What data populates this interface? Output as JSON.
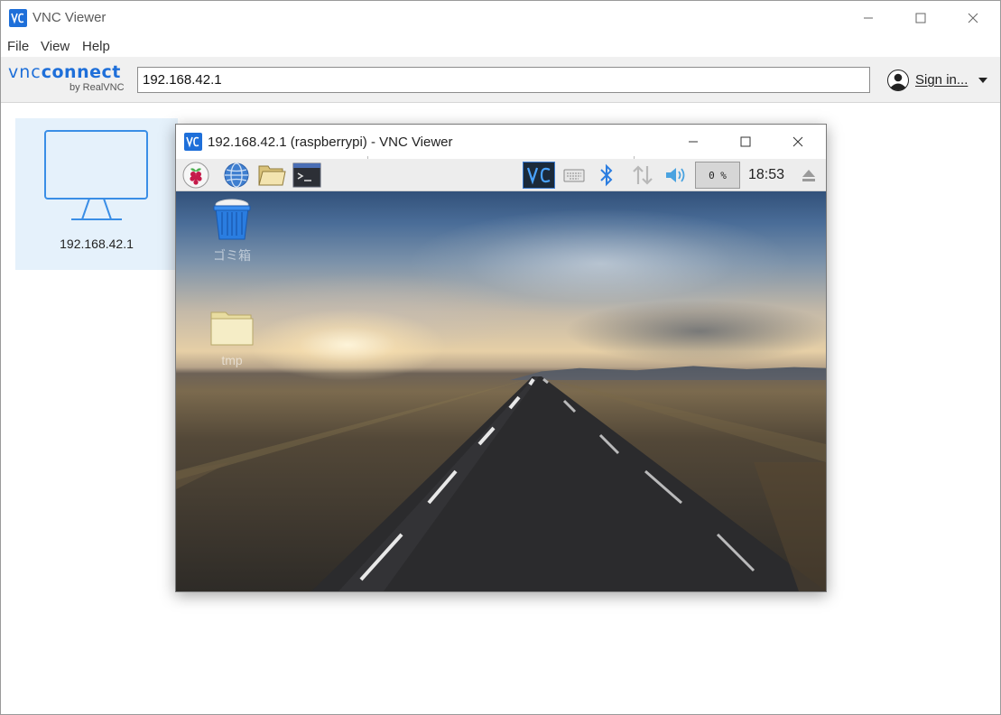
{
  "window": {
    "title": "VNC Viewer"
  },
  "menu": {
    "items": [
      "File",
      "View",
      "Help"
    ]
  },
  "toolbar": {
    "logo_main": "VNC CONNECT",
    "logo_vnc": "vnc",
    "logo_connect": "connect",
    "logo_sub": "by RealVNC",
    "address_value": "192.168.42.1",
    "signin_label": "Sign in..."
  },
  "address_book": {
    "items": [
      {
        "label": "192.168.42.1",
        "icon": "monitor-icon",
        "selected": true
      }
    ]
  },
  "remote_window": {
    "title": "192.168.42.1 (raspberrypi) - VNC Viewer",
    "taskbar": {
      "launchers": [
        "raspberry-menu-icon",
        "web-browser-icon",
        "file-manager-icon",
        "terminal-icon"
      ],
      "tray": [
        "vnc-server-icon",
        "keyboard-icon",
        "bluetooth-icon",
        "network-icon",
        "volume-icon"
      ],
      "cpu_usage": "0 %",
      "clock": "18:53",
      "eject_icon": "eject-icon"
    },
    "desktop_icons": [
      {
        "label": "ゴミ箱",
        "icon": "trash-icon"
      },
      {
        "label": "tmp",
        "icon": "folder-icon"
      }
    ]
  },
  "colors": {
    "accent": "#1e6fd9",
    "selection": "#e5f1fb",
    "toolbar_bg": "#f0f0f0",
    "pi_taskbar_bg": "#ededed"
  }
}
